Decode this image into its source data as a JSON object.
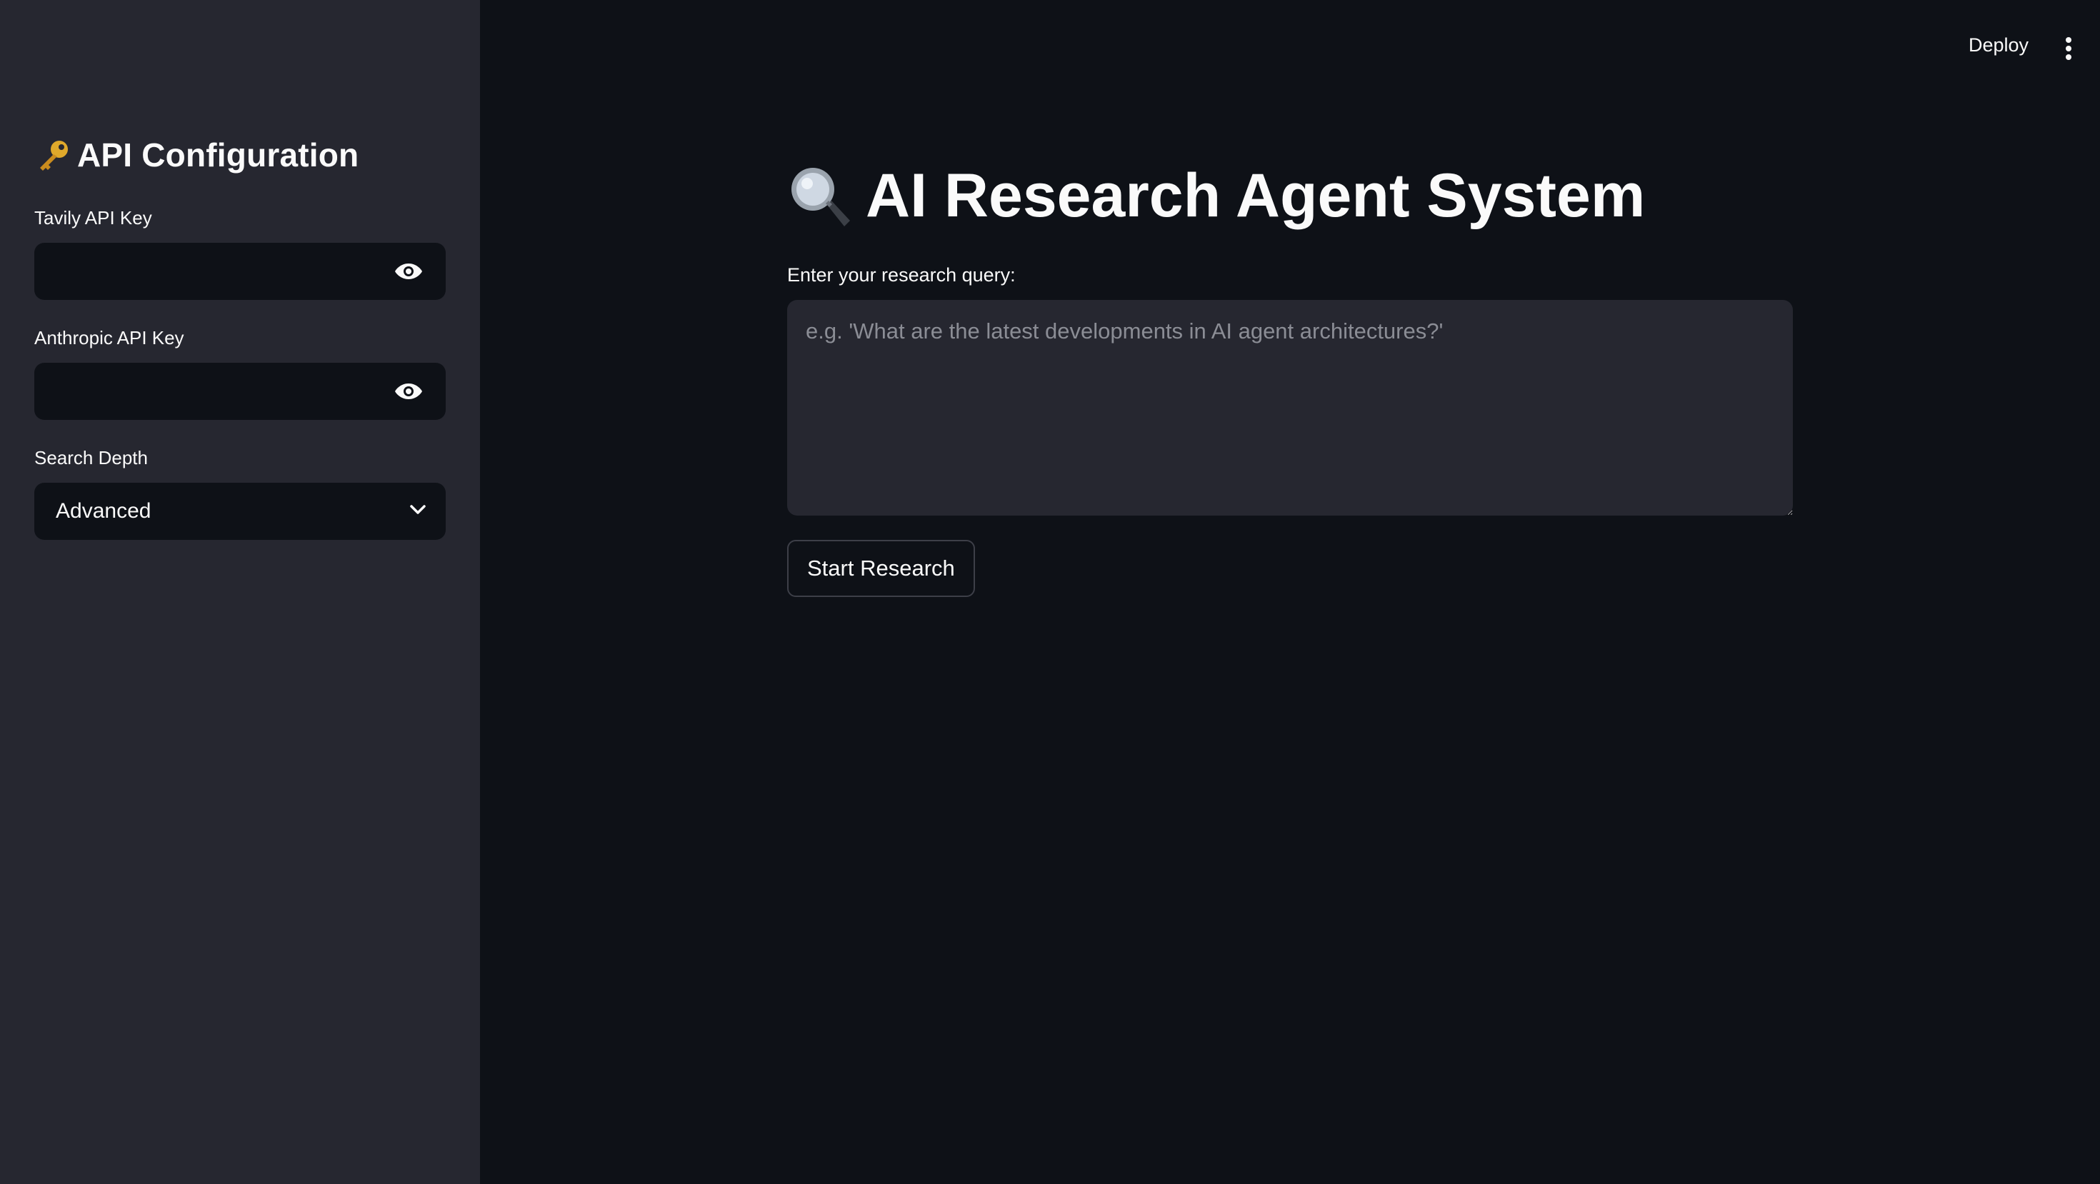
{
  "sidebar": {
    "title_icon": "key-icon",
    "title": "API Configuration",
    "tavily": {
      "label": "Tavily API Key",
      "value": "",
      "toggle_icon": "eye-icon"
    },
    "anthropic": {
      "label": "Anthropic API Key",
      "value": "",
      "toggle_icon": "eye-icon"
    },
    "search_depth": {
      "label": "Search Depth",
      "value": "Advanced",
      "icon": "chevron-down-icon"
    }
  },
  "header": {
    "deploy_label": "Deploy",
    "menu_icon": "kebab-menu-icon"
  },
  "main": {
    "title_icon": "magnifying-glass-icon",
    "title": "AI Research Agent System",
    "query_label": "Enter your research query:",
    "query_placeholder": "e.g. 'What are the latest developments in AI agent architectures?'",
    "query_value": "",
    "start_button_label": "Start Research"
  },
  "colors": {
    "main_background": "#0e1117",
    "sidebar_background": "#262730",
    "input_background": "#0e1117",
    "textarea_background": "#262730",
    "text": "#fafafa",
    "placeholder": "#8b8d95"
  }
}
